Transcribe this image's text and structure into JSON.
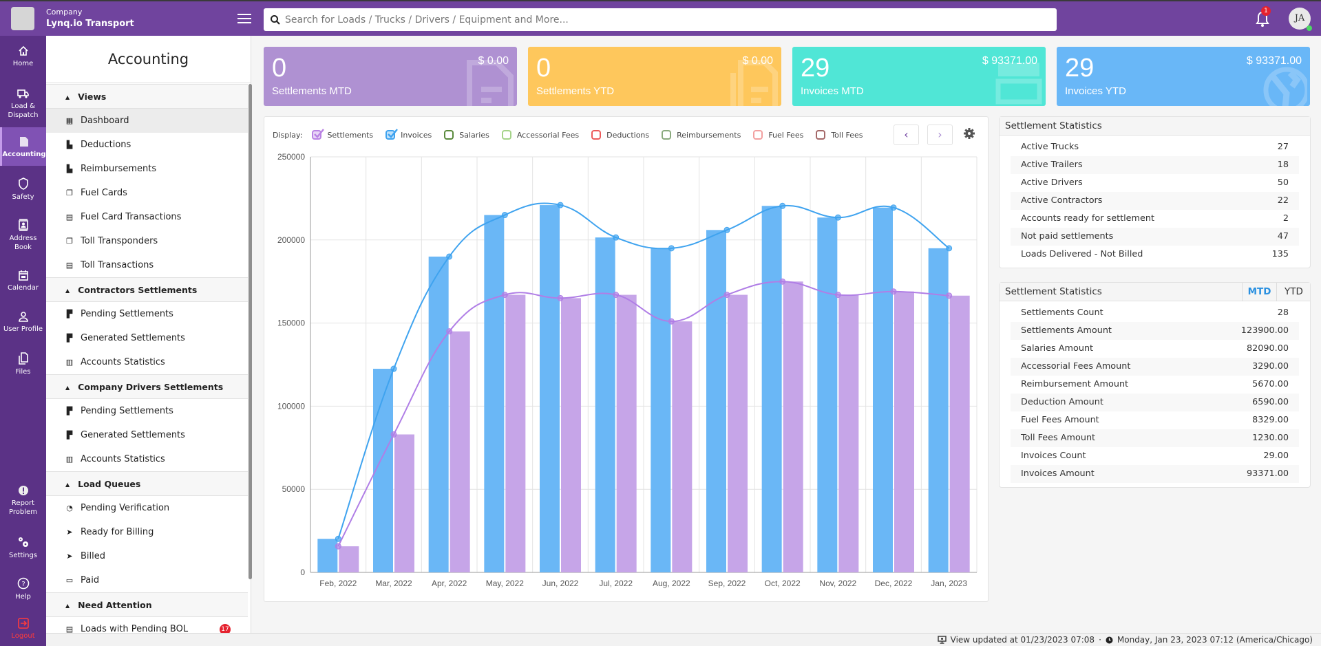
{
  "header": {
    "company_label": "Company",
    "company_name": "Lynq.io Transport",
    "search_placeholder": "Search for Loads / Trucks / Drivers / Equipment and More...",
    "notification_count": "1",
    "user_initials": "JA"
  },
  "rail": {
    "items": [
      {
        "label": "Home",
        "icon": "home-icon"
      },
      {
        "label": "Load &\nDispatch",
        "icon": "truck-icon"
      },
      {
        "label": "Accounting",
        "icon": "document-icon",
        "active": true
      },
      {
        "label": "Safety",
        "icon": "shield-icon"
      },
      {
        "label": "Address\nBook",
        "icon": "address-book-icon"
      },
      {
        "label": "Calendar",
        "icon": "calendar-icon"
      },
      {
        "label": "User Profile",
        "icon": "user-icon"
      },
      {
        "label": "Files",
        "icon": "files-icon"
      },
      {
        "label": "Report\nProblem",
        "icon": "alert-icon"
      },
      {
        "label": "Settings",
        "icon": "gears-icon"
      },
      {
        "label": "Help",
        "icon": "help-icon"
      },
      {
        "label": "Logout",
        "icon": "logout-icon"
      }
    ]
  },
  "subnav": {
    "title": "Accounting",
    "sections": [
      {
        "title": "Views",
        "items": [
          {
            "label": "Dashboard",
            "icon": "dashboard-icon",
            "active": true
          },
          {
            "label": "Deductions",
            "icon": "deduction-icon"
          },
          {
            "label": "Reimbursements",
            "icon": "reimbursement-icon"
          },
          {
            "label": "Fuel Cards",
            "icon": "cards-icon"
          },
          {
            "label": "Fuel Card Transactions",
            "icon": "transactions-icon"
          },
          {
            "label": "Toll Transponders",
            "icon": "cards-icon"
          },
          {
            "label": "Toll Transactions",
            "icon": "transactions-icon"
          }
        ]
      },
      {
        "title": "Contractors Settlements",
        "items": [
          {
            "label": "Pending Settlements",
            "icon": "pending-file-icon"
          },
          {
            "label": "Generated Settlements",
            "icon": "generated-file-icon"
          },
          {
            "label": "Accounts Statistics",
            "icon": "bar-chart-icon"
          }
        ]
      },
      {
        "title": "Company Drivers Settlements",
        "items": [
          {
            "label": "Pending Settlements",
            "icon": "pending-file-icon"
          },
          {
            "label": "Generated Settlements",
            "icon": "generated-file-icon"
          },
          {
            "label": "Accounts Statistics",
            "icon": "bar-chart-icon"
          }
        ]
      },
      {
        "title": "Load Queues",
        "items": [
          {
            "label": "Pending Verification",
            "icon": "user-clock-icon"
          },
          {
            "label": "Ready for Billing",
            "icon": "send-icon"
          },
          {
            "label": "Billed",
            "icon": "send-check-icon"
          },
          {
            "label": "Paid",
            "icon": "money-check-icon"
          }
        ]
      },
      {
        "title": "Need Attention",
        "items": [
          {
            "label": "Loads with Pending BOL",
            "icon": "bol-icon",
            "badge": "17"
          }
        ]
      }
    ]
  },
  "cards": [
    {
      "count": "0",
      "label": "Settlements MTD",
      "amount": "$ 0.00",
      "color": "#af91d2",
      "icon": "file-icon"
    },
    {
      "count": "0",
      "label": "Settlements YTD",
      "amount": "$ 0.00",
      "color": "#fec75c",
      "icon": "file-icon"
    },
    {
      "count": "29",
      "label": "Invoices MTD",
      "amount": "$ 93371.00",
      "color": "#50e6d6",
      "icon": "invoice-icon"
    },
    {
      "count": "29",
      "label": "Invoices YTD",
      "amount": "$ 93371.00",
      "color": "#69b7f7",
      "icon": "globe-icon"
    }
  ],
  "chart_controls": {
    "display_label": "Display:",
    "legend": [
      {
        "label": "Settlements",
        "checked": true,
        "color": "#b982e3"
      },
      {
        "label": "Invoices",
        "checked": true,
        "color": "#3fa3ef"
      },
      {
        "label": "Salaries",
        "checked": false,
        "color": "#5a8a3c"
      },
      {
        "label": "Accessorial Fees",
        "checked": false,
        "color": "#a5d389"
      },
      {
        "label": "Deductions",
        "checked": false,
        "color": "#ec5a5a"
      },
      {
        "label": "Reimbursements",
        "checked": false,
        "color": "#8aaa7e"
      },
      {
        "label": "Fuel Fees",
        "checked": false,
        "color": "#f2a0a0"
      },
      {
        "label": "Toll Fees",
        "checked": false,
        "color": "#a46868"
      }
    ],
    "prev_label": "‹",
    "next_label": "›"
  },
  "chart_data": {
    "type": "bar",
    "title": "",
    "xlabel": "",
    "ylabel": "",
    "ylim": [
      0,
      250000
    ],
    "yticks": [
      0,
      50000,
      100000,
      150000,
      200000,
      250000
    ],
    "grid": true,
    "categories": [
      "Feb, 2022",
      "Mar, 2022",
      "Apr, 2022",
      "May, 2022",
      "Jun, 2022",
      "Jul, 2022",
      "Aug, 2022",
      "Sep, 2022",
      "Oct, 2022",
      "Nov, 2022",
      "Dec, 2022",
      "Jan, 2023"
    ],
    "series": [
      {
        "name": "Invoices",
        "type": "bar+line",
        "bar_color": "#6ab7f6",
        "line_color": "#3fa3ef",
        "values": [
          20200,
          122500,
          190000,
          215000,
          221000,
          201500,
          195000,
          206000,
          220500,
          213500,
          219500,
          195000
        ]
      },
      {
        "name": "Settlements",
        "type": "bar+line",
        "bar_color": "#c6a5e8",
        "line_color": "#b07ee6",
        "values": [
          15700,
          83000,
          145000,
          167000,
          165000,
          167000,
          151000,
          167000,
          175000,
          167000,
          169000,
          166500
        ]
      }
    ]
  },
  "stats1": {
    "title": "Settlement Statistics",
    "rows": [
      {
        "label": "Active Trucks",
        "value": "27"
      },
      {
        "label": "Active Trailers",
        "value": "18"
      },
      {
        "label": "Active Drivers",
        "value": "50"
      },
      {
        "label": "Active Contractors",
        "value": "22"
      },
      {
        "label": "Accounts ready for settlement",
        "value": "2"
      },
      {
        "label": "Not paid settlements",
        "value": "47"
      },
      {
        "label": "Loads Delivered - Not Billed",
        "value": "135"
      }
    ]
  },
  "stats2": {
    "title": "Settlement Statistics",
    "tab_mtd": "MTD",
    "tab_ytd": "YTD",
    "active_tab": "MTD",
    "rows": [
      {
        "label": "Settlements Count",
        "value": "28"
      },
      {
        "label": "Settlements Amount",
        "value": "123900.00"
      },
      {
        "label": "Salaries Amount",
        "value": "82090.00"
      },
      {
        "label": "Accessorial Fees Amount",
        "value": "3290.00"
      },
      {
        "label": "Reimbursement Amount",
        "value": "5670.00"
      },
      {
        "label": "Deduction Amount",
        "value": "6590.00"
      },
      {
        "label": "Fuel Fees Amount",
        "value": "8329.00"
      },
      {
        "label": "Toll Fees Amount",
        "value": "1230.00"
      },
      {
        "label": "Invoices Count",
        "value": "29.00"
      },
      {
        "label": "Invoices Amount",
        "value": "93371.00"
      }
    ]
  },
  "footer": {
    "view_updated": "View updated at 01/23/2023 07:08",
    "separator": "·",
    "datetime": "Monday, Jan 23, 2023 07:12 (America/Chicago)"
  }
}
